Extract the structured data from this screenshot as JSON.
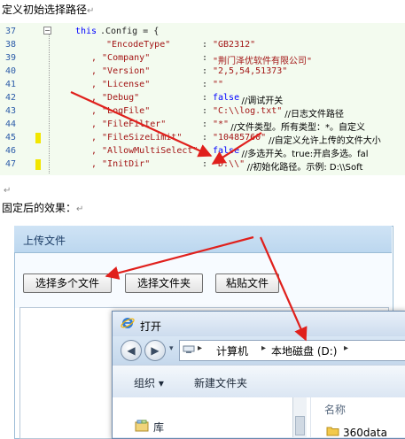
{
  "heading": "定义初始选择路径",
  "paragraph_mark": "↵",
  "code": {
    "lines": [
      {
        "num": "37",
        "parts": [
          {
            "t": "this",
            "c": "kw"
          },
          {
            "t": ".Config = {",
            "c": "plain"
          }
        ]
      },
      {
        "num": "38",
        "parts": [
          {
            "t": "\"EncodeType\"",
            "c": "str"
          },
          {
            "t": ": ",
            "c": "plain"
          },
          {
            "t": "\"GB2312\"",
            "c": "str"
          }
        ]
      },
      {
        "num": "39",
        "parts": [
          {
            "t": ", \"Company\"",
            "c": "str"
          },
          {
            "t": ": ",
            "c": "plain"
          },
          {
            "t": "\"荆门泽优软件有限公司\"",
            "c": "str"
          }
        ]
      },
      {
        "num": "40",
        "parts": [
          {
            "t": ", \"Version\"",
            "c": "str"
          },
          {
            "t": ": ",
            "c": "plain"
          },
          {
            "t": "\"2,5,54,51373\"",
            "c": "str"
          }
        ]
      },
      {
        "num": "41",
        "parts": [
          {
            "t": ", \"License\"",
            "c": "str"
          },
          {
            "t": ": ",
            "c": "plain"
          },
          {
            "t": "\"\"",
            "c": "str"
          }
        ]
      },
      {
        "num": "42",
        "parts": [
          {
            "t": ", \"Debug\"",
            "c": "str"
          },
          {
            "t": ": ",
            "c": "plain"
          },
          {
            "t": "false",
            "c": "kw"
          },
          {
            "t": "//调试开关",
            "c": "cmt"
          }
        ]
      },
      {
        "num": "43",
        "parts": [
          {
            "t": ", \"LogFile\"",
            "c": "str"
          },
          {
            "t": ": ",
            "c": "plain"
          },
          {
            "t": "\"C:\\\\log.txt\"",
            "c": "str"
          },
          {
            "t": "//日志文件路径",
            "c": "cmt"
          }
        ]
      },
      {
        "num": "44",
        "parts": [
          {
            "t": ", \"FileFilter\"",
            "c": "str"
          },
          {
            "t": ": ",
            "c": "plain"
          },
          {
            "t": "\"*\"",
            "c": "str"
          },
          {
            "t": "//文件类型。所有类型：*。自定义",
            "c": "cmt"
          }
        ]
      },
      {
        "num": "45",
        "parts": [
          {
            "t": ", \"FileSizeLimit\"",
            "c": "str"
          },
          {
            "t": ": ",
            "c": "plain"
          },
          {
            "t": "\"10485760\"",
            "c": "str"
          },
          {
            "t": "//自定义允许上传的文件大小",
            "c": "cmt"
          }
        ]
      },
      {
        "num": "46",
        "parts": [
          {
            "t": ", \"AllowMultiSelect\"",
            "c": "str"
          },
          {
            "t": ": ",
            "c": "plain"
          },
          {
            "t": "false",
            "c": "kw"
          },
          {
            "t": "//多选开关。true:开启多选。fal",
            "c": "cmt"
          }
        ]
      },
      {
        "num": "47",
        "parts": [
          {
            "t": ", \"InitDir\"",
            "c": "str"
          },
          {
            "t": ": ",
            "c": "plain"
          },
          {
            "t": "\"D:\\\\\"",
            "c": "str"
          },
          {
            "t": "//初始化路径。示例: D:\\\\Soft",
            "c": "cmt"
          }
        ]
      }
    ]
  },
  "after_heading": "固定后的效果：",
  "upload_window": {
    "title": "上传文件",
    "buttons": [
      "选择多个文件",
      "选择文件夹",
      "粘贴文件"
    ]
  },
  "open_dialog": {
    "title": "打开",
    "breadcrumbs": [
      "计算机",
      "本地磁盘 (D:)"
    ],
    "commands": {
      "organize": "组织 ▾",
      "new_folder": "新建文件夹"
    },
    "sidebar_item": "库",
    "column_name": "名称",
    "first_item": "360data"
  },
  "colors": {
    "arrow": "#e0201c",
    "highlight": "#f2e600",
    "link": "#0000ff",
    "string": "#a31515"
  }
}
